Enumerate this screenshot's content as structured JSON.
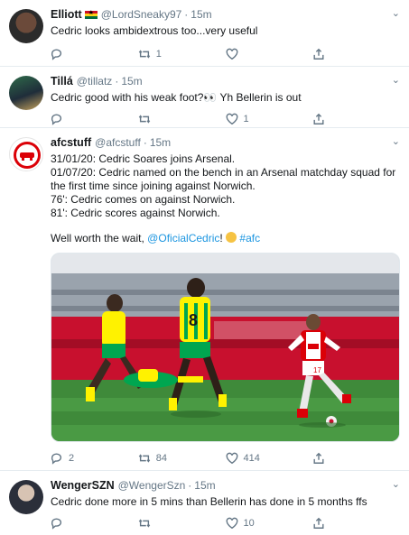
{
  "tweets": [
    {
      "name": "Elliott",
      "handle": "@LordSneaky97",
      "time": "15m",
      "text": "Cedric looks ambidextrous too...very useful",
      "reply_count": "",
      "retweet_count": "1",
      "like_count": ""
    },
    {
      "name": "Tillá",
      "handle": "@tillatz",
      "time": "15m",
      "text": "Cedric good with his weak foot?👀 Yh Bellerin is out",
      "reply_count": "",
      "retweet_count": "",
      "like_count": "1"
    },
    {
      "name": "afcstuff",
      "handle": "@afcstuff",
      "time": "15m",
      "lines": [
        "31/01/20: Cedric Soares joins Arsenal.",
        "01/07/20: Cedric named on the bench in an Arsenal matchday squad for the first time since joining against Norwich.",
        "76': Cedric comes on against Norwich.",
        "81': Cedric scores against Norwich."
      ],
      "closing_text": "Well worth the wait,",
      "mention": "@OficialCedric",
      "hashtag": "#afc",
      "reply_count": "2",
      "retweet_count": "84",
      "like_count": "414"
    },
    {
      "name": "WengerSZN",
      "handle": "@WengerSzn",
      "time": "15m",
      "text": "Cedric done more in 5 mins than Bellerin has done in 5 months ffs",
      "reply_count": "",
      "retweet_count": "",
      "like_count": "10"
    }
  ],
  "separator": "·",
  "icons": {
    "reply": "reply-icon",
    "retweet": "retweet-icon",
    "like": "heart-icon",
    "share": "share-icon",
    "caret": "chevron-down-icon"
  },
  "colors": {
    "link": "#1b95e0",
    "muted": "#657786",
    "arsenal_red": "#db0007",
    "norwich_yellow": "#fff200",
    "norwich_green": "#00a650"
  }
}
